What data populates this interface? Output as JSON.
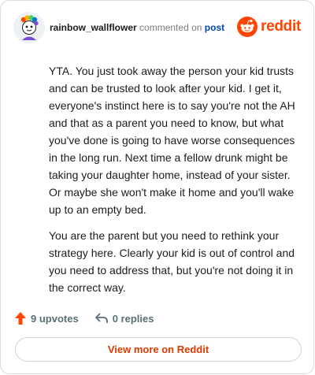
{
  "comment": {
    "username": "rainbow_wallflower",
    "commented_on": "commented on",
    "post_link": "post",
    "paragraphs": [
      "YTA. You just took away the person your kid trusts and can be trusted to look after your kid. I get it, everyone's instinct here is to say you're not the AH and that as a parent you need to know, but what you've done is going to have worse consequences in the long run. Next time a fellow drunk might be taking your daughter home, instead of your sister. Or maybe she won't make it home and you'll wake up to an empty bed.",
      "You are the parent but you need to rethink your strategy here. Clearly your kid is out of control and you need to address that, but you're not doing it in the correct way."
    ]
  },
  "brand": {
    "name": "reddit",
    "color": "#ff4500"
  },
  "actions": {
    "upvotes": "9 upvotes",
    "replies": "0 replies",
    "upvote_color": "#ff4500"
  },
  "view_more_label": "View more on Reddit",
  "icons": {
    "avatar": "avatar-icon",
    "logo": "reddit-logo-icon",
    "upvote": "upvote-arrow-icon",
    "reply": "reply-arrow-icon"
  }
}
